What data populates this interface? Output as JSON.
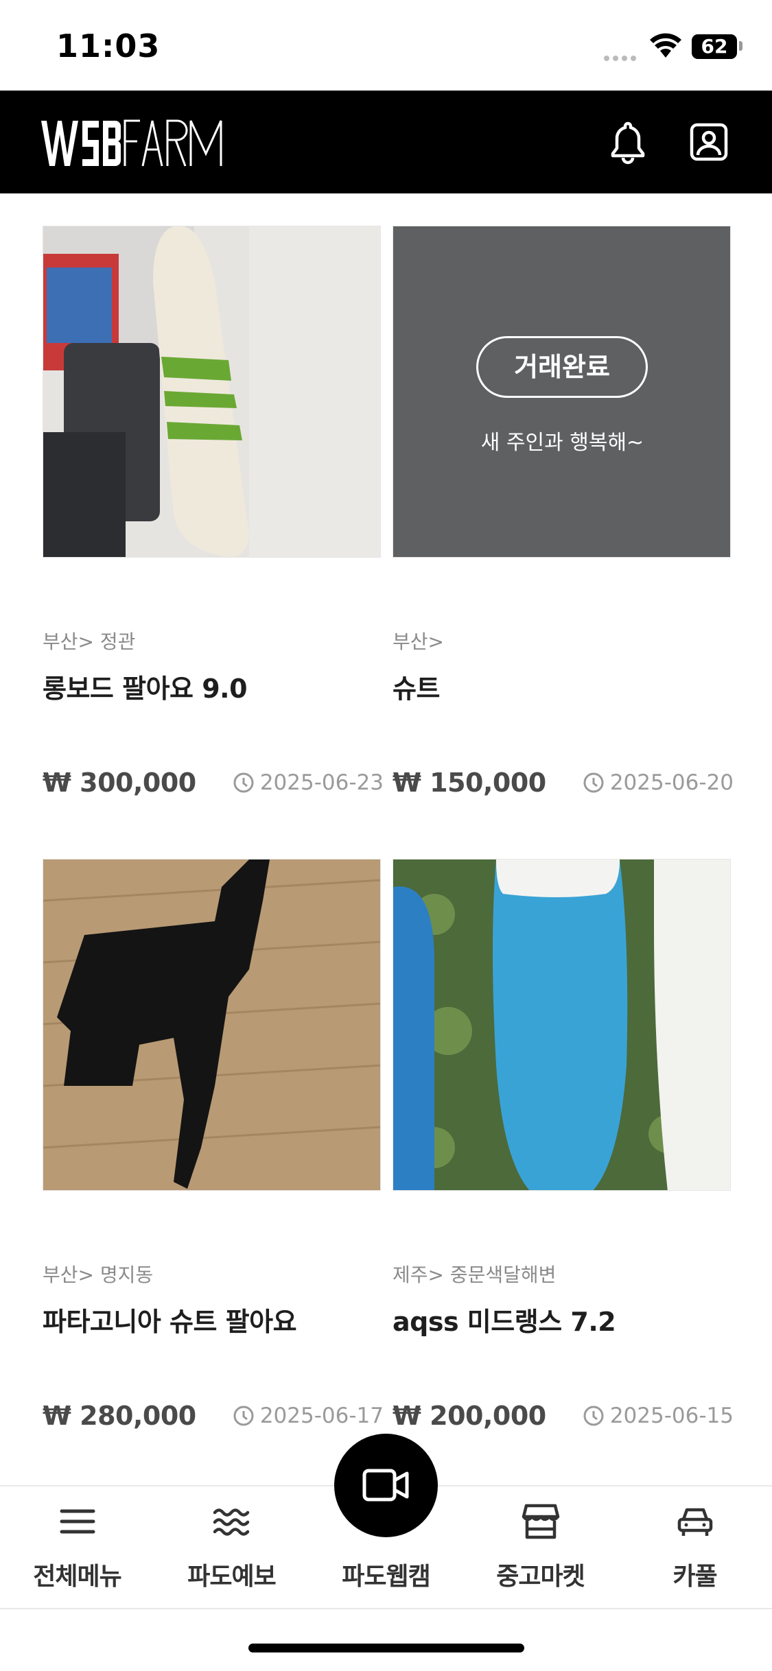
{
  "status_bar": {
    "time": "11:03",
    "battery": "62"
  },
  "header": {
    "logo_text": "WSBFARM",
    "logo_icon": "brand-logo",
    "right_icons": [
      "bell-icon",
      "profile-icon"
    ]
  },
  "listings": [
    {
      "location": "부산> 정관",
      "title": "롱보드 팔아요 9.0",
      "price": "₩ 300,000",
      "date": "2025-06-23",
      "sold": false,
      "image": "longboard-photo"
    },
    {
      "location": "부산>",
      "title": "슈트",
      "price": "₩ 150,000",
      "date": "2025-06-20",
      "sold": true,
      "sold_label": "거래완료",
      "sold_sub": "새 주인과 행복해~"
    },
    {
      "location": "부산> 명지동",
      "title": "파타고니아 슈트 팔아요",
      "price": "₩ 280,000",
      "date": "2025-06-17",
      "sold": false,
      "image": "wetsuit-photo"
    },
    {
      "location": "제주> 중문색달해변",
      "title": "aqss 미드랭스 7.2",
      "price": "₩ 200,000",
      "date": "2025-06-15",
      "sold": false,
      "image": "surfboard-photo"
    }
  ],
  "tabbar": {
    "tabs": [
      {
        "label": "전체메뉴",
        "icon": "menu-icon"
      },
      {
        "label": "파도예보",
        "icon": "wave-icon"
      },
      {
        "label": "파도웹캠",
        "icon": "video-camera-icon"
      },
      {
        "label": "중고마켓",
        "icon": "store-icon"
      },
      {
        "label": "카풀",
        "icon": "car-icon"
      }
    ]
  },
  "colors": {
    "header_bg": "#000000",
    "sold_overlay": "#5e6061",
    "price": "#4a4a4a",
    "muted": "#8a8a8a"
  }
}
